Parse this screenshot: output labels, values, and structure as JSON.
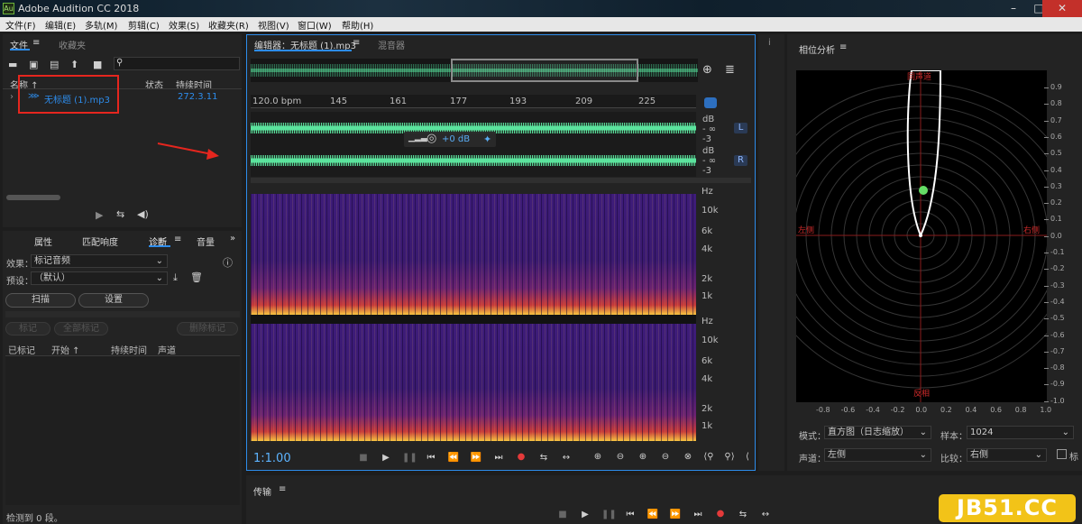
{
  "window": {
    "title": "Adobe Audition CC 2018",
    "app_icon": "Au"
  },
  "menu": [
    "文件(F)",
    "编辑(E)",
    "多轨(M)",
    "剪辑(C)",
    "效果(S)",
    "收藏夹(R)",
    "视图(V)",
    "窗口(W)",
    "帮助(H)"
  ],
  "files_panel": {
    "tabs": [
      "文件",
      "收藏夹"
    ],
    "search_placeholder": "",
    "columns": {
      "name": "名称 ↑",
      "status": "状态",
      "duration": "持续时间"
    },
    "file": {
      "name": "无标题 (1).mp3",
      "duration": "272.3.11"
    }
  },
  "props_panel": {
    "tabs": [
      "属性",
      "匹配响度",
      "诊断",
      "音量"
    ],
    "effect_label": "效果：",
    "effect_value": "标记音频",
    "preset_label": "预设：",
    "preset_value": "（默认）",
    "scan_btn": "扫描",
    "settings_btn": "设置",
    "mark_btn": "标记",
    "mark_all_btn": "全部标记",
    "clear_btn": "删除标记",
    "columns": [
      "已标记",
      "开始 ↑",
      "持续时间",
      "声道"
    ],
    "status": "检测到 0 段。"
  },
  "editor": {
    "tab": "编辑器：无标题 (1).mp3",
    "mixer_tab": "混音器",
    "ruler": [
      "120.0 bpm",
      "145",
      "161",
      "177",
      "193",
      "209",
      "225"
    ],
    "gain": "+0 dB",
    "amp_scale": [
      "dB",
      "- ∞",
      "-3"
    ],
    "channels": [
      "L",
      "R"
    ],
    "freq_scale": [
      "Hz",
      "10k",
      "6k",
      "4k",
      "2k",
      "1k"
    ],
    "time": "1:1.00"
  },
  "phase_panel": {
    "title": "相位分析",
    "labels": {
      "top": "同声道",
      "left": "左侧",
      "right": "右侧",
      "bottom": "反相"
    },
    "y_ticks": [
      "0.9",
      "0.8",
      "0.7",
      "0.6",
      "0.5",
      "0.4",
      "0.3",
      "0.2",
      "0.1",
      "0.0",
      "-0.1",
      "-0.2",
      "-0.3",
      "-0.4",
      "-0.5",
      "-0.6",
      "-0.7",
      "-0.8",
      "-0.9",
      "-1.0"
    ],
    "x_ticks": [
      "-0.8",
      "-0.6",
      "-0.4",
      "-0.2",
      "0.0",
      "0.2",
      "0.4",
      "0.6",
      "0.8",
      "1.0"
    ],
    "mode_label": "模式：",
    "mode_value": "直方图（日志缩放）",
    "samples_label": "样本：",
    "samples_value": "1024",
    "channel_label": "声道：",
    "channel_value": "左侧",
    "compare_label": "比较：",
    "compare_value": "右侧",
    "check_label": "标"
  },
  "transport": {
    "title": "传输"
  },
  "watermark": "JB51.CC",
  "colors": {
    "waveform": "#5be39d",
    "selection": "#2d8ceb",
    "highlight": "#e5261e",
    "record": "#e43a3a"
  }
}
